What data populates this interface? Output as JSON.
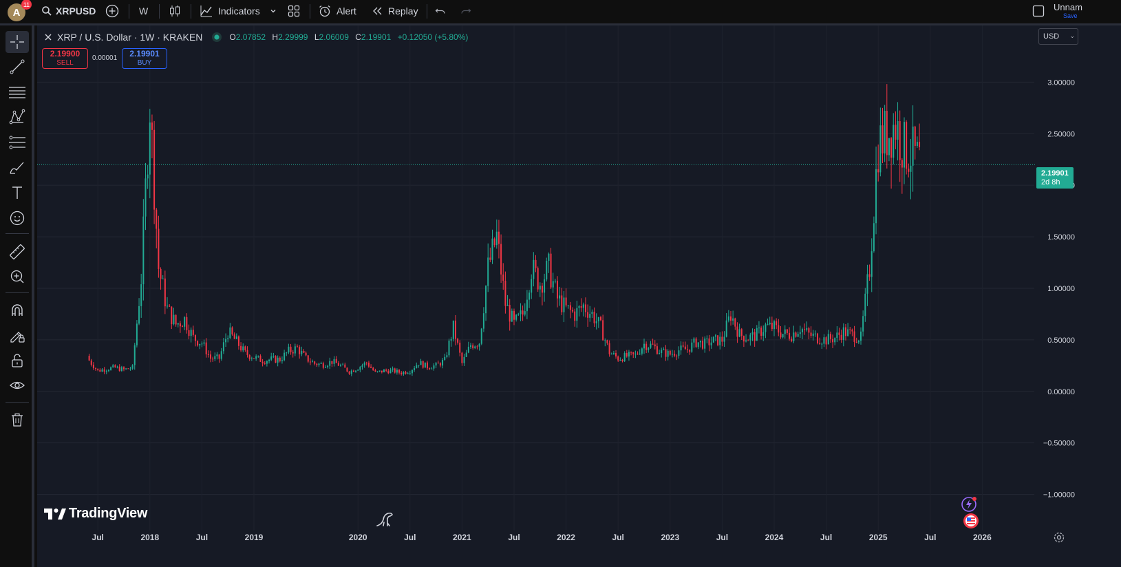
{
  "toolbar": {
    "avatar_letter": "A",
    "notification_count": "11",
    "symbol": "XRPUSD",
    "interval": "W",
    "indicators_label": "Indicators",
    "alert_label": "Alert",
    "replay_label": "Replay",
    "layout_name": "Unnam",
    "save_label": "Save"
  },
  "legend": {
    "title": "XRP / U.S. Dollar · 1W · KRAKEN",
    "open_label": "O",
    "open": "2.07852",
    "high_label": "H",
    "high": "2.29999",
    "low_label": "L",
    "low": "2.06009",
    "close_label": "C",
    "close": "2.19901",
    "change": "+0.12050 (+5.80%)"
  },
  "trade": {
    "sell_price": "2.19900",
    "sell_label": "SELL",
    "spread": "0.00001",
    "buy_price": "2.19901",
    "buy_label": "BUY"
  },
  "currency": "USD",
  "last_price": {
    "price": "2.19901",
    "countdown": "2d 8h"
  },
  "brand": "TradingView",
  "colors": {
    "up": "#22ab94",
    "down": "#f23645",
    "accent": "#2962ff",
    "background": "#161a25"
  },
  "left_tools": [
    "crosshair-icon",
    "trend-line-icon",
    "fib-retracement-icon",
    "pattern-icon",
    "forecasting-icon",
    "brush-icon",
    "text-icon",
    "emoji-icon",
    "ruler-icon",
    "zoom-in-icon",
    "magnet-icon",
    "lock-drawings-icon",
    "lock-icon",
    "eye-icon",
    "trash-icon"
  ],
  "chart_data": {
    "type": "candlestick",
    "y_tick_labels": [
      "3.00000",
      "2.50000",
      "2.00000",
      "1.50000",
      "1.00000",
      "0.50000",
      "0.00000",
      "−0.50000",
      "−1.00000"
    ],
    "y_ticks": [
      3.0,
      2.5,
      2.0,
      1.5,
      1.0,
      0.5,
      0.0,
      -0.5,
      -1.0
    ],
    "ylim": [
      -1.35,
      3.55
    ],
    "x_tick_labels": [
      "Jul",
      "2018",
      "Jul",
      "2019",
      "2020",
      "Jul",
      "2021",
      "Jul",
      "2022",
      "Jul",
      "2023",
      "Jul",
      "2024",
      "Jul",
      "2025",
      "Jul",
      "2026"
    ],
    "x_ticks": [
      "2017-07",
      "2018-01",
      "2018-07",
      "2019-01",
      "2020-01",
      "2020-07",
      "2021-01",
      "2021-07",
      "2022-01",
      "2022-07",
      "2023-01",
      "2023-07",
      "2024-01",
      "2024-07",
      "2025-01",
      "2025-07",
      "2026-01"
    ],
    "xlim": [
      "2016-12",
      "2026-07"
    ],
    "last_price": 2.19901,
    "grid": true,
    "series": [
      {
        "name": "XRPUSD",
        "points": [
          [
            "2017-06",
            0.3
          ],
          [
            "2017-07",
            0.2
          ],
          [
            "2017-08",
            0.22
          ],
          [
            "2017-09",
            0.23
          ],
          [
            "2017-10",
            0.21
          ],
          [
            "2017-11",
            0.23
          ],
          [
            "2017-12",
            1.1
          ],
          [
            "2018-01",
            2.8
          ],
          [
            "2018-02",
            1.2
          ],
          [
            "2018-03",
            0.8
          ],
          [
            "2018-04",
            0.65
          ],
          [
            "2018-05",
            0.7
          ],
          [
            "2018-06",
            0.52
          ],
          [
            "2018-07",
            0.47
          ],
          [
            "2018-08",
            0.32
          ],
          [
            "2018-09",
            0.32
          ],
          [
            "2018-10",
            0.58
          ],
          [
            "2018-11",
            0.48
          ],
          [
            "2018-12",
            0.37
          ],
          [
            "2019-01",
            0.33
          ],
          [
            "2019-02",
            0.3
          ],
          [
            "2019-03",
            0.31
          ],
          [
            "2019-04",
            0.31
          ],
          [
            "2019-05",
            0.39
          ],
          [
            "2019-06",
            0.42
          ],
          [
            "2019-07",
            0.32
          ],
          [
            "2019-08",
            0.27
          ],
          [
            "2019-09",
            0.26
          ],
          [
            "2019-10",
            0.29
          ],
          [
            "2019-11",
            0.25
          ],
          [
            "2019-12",
            0.19
          ],
          [
            "2020-01",
            0.23
          ],
          [
            "2020-02",
            0.28
          ],
          [
            "2020-03",
            0.18
          ],
          [
            "2020-04",
            0.2
          ],
          [
            "2020-05",
            0.2
          ],
          [
            "2020-06",
            0.18
          ],
          [
            "2020-07",
            0.2
          ],
          [
            "2020-08",
            0.28
          ],
          [
            "2020-09",
            0.24
          ],
          [
            "2020-10",
            0.25
          ],
          [
            "2020-11",
            0.3
          ],
          [
            "2020-12",
            0.62
          ],
          [
            "2021-01",
            0.27
          ],
          [
            "2021-02",
            0.45
          ],
          [
            "2021-03",
            0.48
          ],
          [
            "2021-04",
            1.2
          ],
          [
            "2021-05",
            1.5
          ],
          [
            "2021-06",
            0.85
          ],
          [
            "2021-07",
            0.65
          ],
          [
            "2021-08",
            0.75
          ],
          [
            "2021-09",
            1.2
          ],
          [
            "2021-10",
            1.05
          ],
          [
            "2021-11",
            1.2
          ],
          [
            "2021-12",
            0.9
          ],
          [
            "2022-01",
            0.8
          ],
          [
            "2022-02",
            0.75
          ],
          [
            "2022-03",
            0.83
          ],
          [
            "2022-04",
            0.75
          ],
          [
            "2022-05",
            0.62
          ],
          [
            "2022-06",
            0.38
          ],
          [
            "2022-07",
            0.32
          ],
          [
            "2022-08",
            0.34
          ],
          [
            "2022-09",
            0.35
          ],
          [
            "2022-10",
            0.46
          ],
          [
            "2022-11",
            0.44
          ],
          [
            "2022-12",
            0.38
          ],
          [
            "2023-01",
            0.36
          ],
          [
            "2023-02",
            0.4
          ],
          [
            "2023-03",
            0.41
          ],
          [
            "2023-04",
            0.48
          ],
          [
            "2023-05",
            0.46
          ],
          [
            "2023-06",
            0.49
          ],
          [
            "2023-07",
            0.5
          ],
          [
            "2023-08",
            0.75
          ],
          [
            "2023-09",
            0.55
          ],
          [
            "2023-10",
            0.52
          ],
          [
            "2023-11",
            0.55
          ],
          [
            "2023-12",
            0.63
          ],
          [
            "2024-01",
            0.62
          ],
          [
            "2024-02",
            0.56
          ],
          [
            "2024-03",
            0.55
          ],
          [
            "2024-04",
            0.62
          ],
          [
            "2024-05",
            0.55
          ],
          [
            "2024-06",
            0.52
          ],
          [
            "2024-07",
            0.5
          ],
          [
            "2024-08",
            0.52
          ],
          [
            "2024-09",
            0.58
          ],
          [
            "2024-10",
            0.55
          ],
          [
            "2024-11",
            0.52
          ],
          [
            "2024-12",
            1.2
          ],
          [
            "2025-01",
            2.4
          ],
          [
            "2025-02",
            2.5
          ],
          [
            "2025-03",
            2.6
          ],
          [
            "2025-04",
            2.35
          ],
          [
            "2025-05",
            2.3
          ],
          [
            "2025-06",
            2.2
          ]
        ]
      }
    ]
  }
}
